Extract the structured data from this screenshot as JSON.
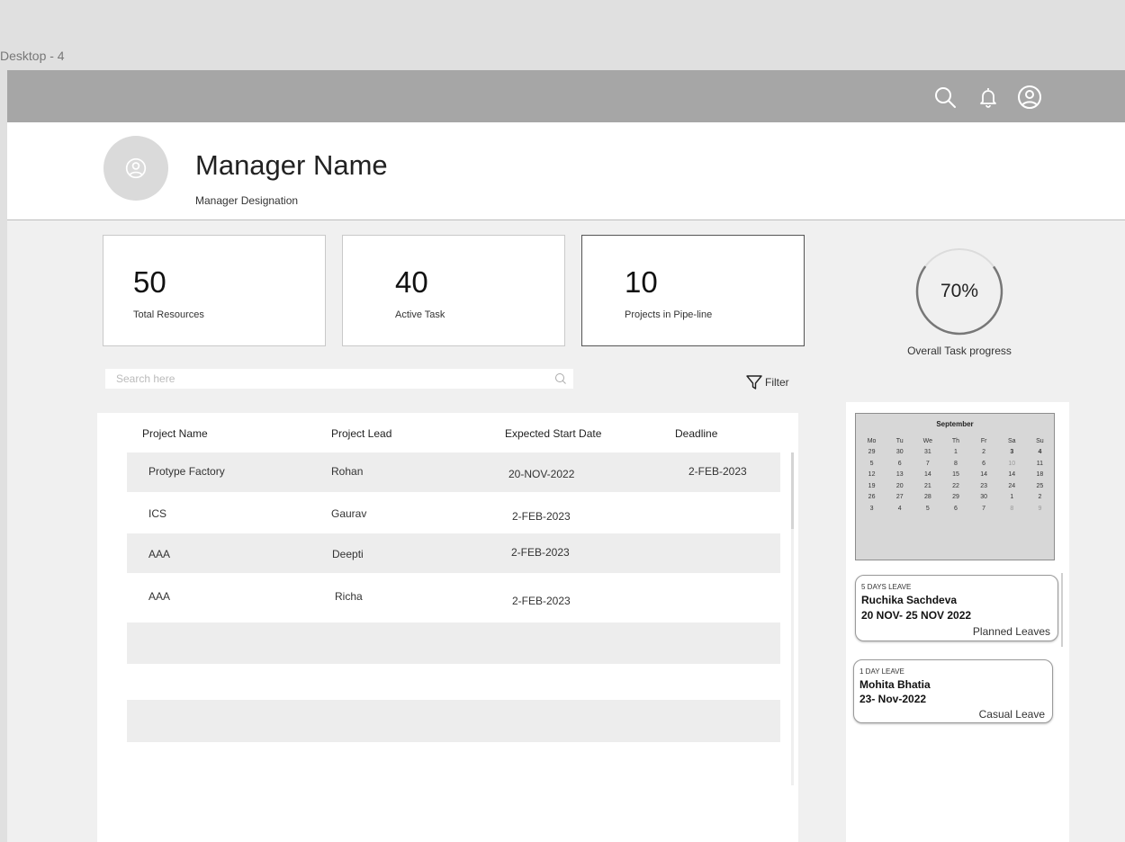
{
  "frame": {
    "label": "Desktop - 4"
  },
  "topbar": {
    "icons": [
      "search-icon",
      "bell-icon",
      "user-icon"
    ]
  },
  "header": {
    "name": "Manager Name",
    "designation": "Manager Designation"
  },
  "stats": [
    {
      "value": "50",
      "label": "Total Resources"
    },
    {
      "value": "40",
      "label": "Active Task"
    },
    {
      "value": "10",
      "label": "Projects in Pipe-line"
    }
  ],
  "progress": {
    "value": "70%",
    "fraction": 0.7,
    "label": "Overall Task progress"
  },
  "search": {
    "placeholder": "Search here"
  },
  "filter": {
    "label": "Filter"
  },
  "table": {
    "columns": [
      "Project Name",
      "Project Lead",
      "Expected Start Date",
      "Deadline"
    ],
    "rows": [
      {
        "name": "Protype Factory",
        "lead": "Rohan",
        "start": "20-NOV-2022",
        "deadline": "2-FEB-2023"
      },
      {
        "name": "ICS",
        "lead": "Gaurav",
        "start": "2-FEB-2023",
        "deadline": ""
      },
      {
        "name": "AAA",
        "lead": "Deepti",
        "start": "2-FEB-2023",
        "deadline": ""
      },
      {
        "name": "AAA",
        "lead": "Richa",
        "start": "2-FEB-2023",
        "deadline": ""
      }
    ]
  },
  "calendar": {
    "month": "September",
    "weekdays": [
      "Mo",
      "Tu",
      "We",
      "Th",
      "Fr",
      "Sa",
      "Su"
    ],
    "days": [
      "29",
      "30",
      "31",
      "1",
      "2",
      "3",
      "4",
      "5",
      "6",
      "7",
      "8",
      "6",
      "10",
      "11",
      "12",
      "13",
      "14",
      "15",
      "14",
      "14",
      "18",
      "19",
      "20",
      "21",
      "22",
      "23",
      "24",
      "25",
      "26",
      "27",
      "28",
      "29",
      "30",
      "1",
      "2",
      "3",
      "4",
      "5",
      "6",
      "7",
      "8",
      "9"
    ]
  },
  "leaves": [
    {
      "tag": "5 DAYS LEAVE",
      "name": "Ruchika Sachdeva",
      "dates": "20 NOV- 25 NOV 2022",
      "type": "Planned Leaves"
    },
    {
      "tag": "1 DAY LEAVE",
      "name": "Mohita Bhatia",
      "dates": "23- Nov-2022",
      "type": "Casual Leave"
    }
  ],
  "colors": {
    "topbar": "#a6a6a6",
    "background": "#f0f0f0",
    "row_shade": "#ededed"
  }
}
